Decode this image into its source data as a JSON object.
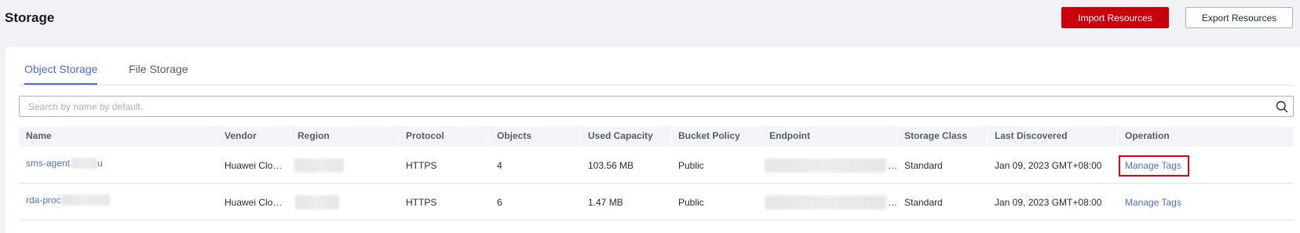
{
  "header": {
    "title": "Storage",
    "import_label": "Import Resources",
    "export_label": "Export Resources"
  },
  "tabs": [
    {
      "label": "Object Storage",
      "active": true
    },
    {
      "label": "File Storage",
      "active": false
    }
  ],
  "search": {
    "placeholder": "Search by name by default.",
    "value": ""
  },
  "table": {
    "columns": [
      "Name",
      "Vendor",
      "Region",
      "Protocol",
      "Objects",
      "Used Capacity",
      "Bucket Policy",
      "Endpoint",
      "Storage Class",
      "Last Discovered",
      "Operation"
    ],
    "rows": [
      {
        "name": "sms-agent",
        "name_suffix": "u",
        "vendor": "Huawei Clo…",
        "region": "",
        "protocol": "HTTPS",
        "objects": "4",
        "used_capacity": "103.56 MB",
        "bucket_policy": "Public",
        "endpoint": "…",
        "storage_class": "Standard",
        "last_discovered": "Jan 09, 2023 GMT+08:00",
        "operation": "Manage Tags",
        "highlighted": true
      },
      {
        "name": "rda-proc",
        "name_suffix": "",
        "vendor": "Huawei Clo…",
        "region": "",
        "protocol": "HTTPS",
        "objects": "6",
        "used_capacity": "1.47 MB",
        "bucket_policy": "Public",
        "endpoint": "…",
        "storage_class": "Standard",
        "last_discovered": "Jan 09, 2023 GMT+08:00",
        "operation": "Manage Tags",
        "highlighted": false
      }
    ]
  },
  "colors": {
    "accent": "#526ecc",
    "primary_button": "#c7000b",
    "highlight_box": "#e3000f"
  },
  "icons": {
    "search": "search-icon"
  }
}
